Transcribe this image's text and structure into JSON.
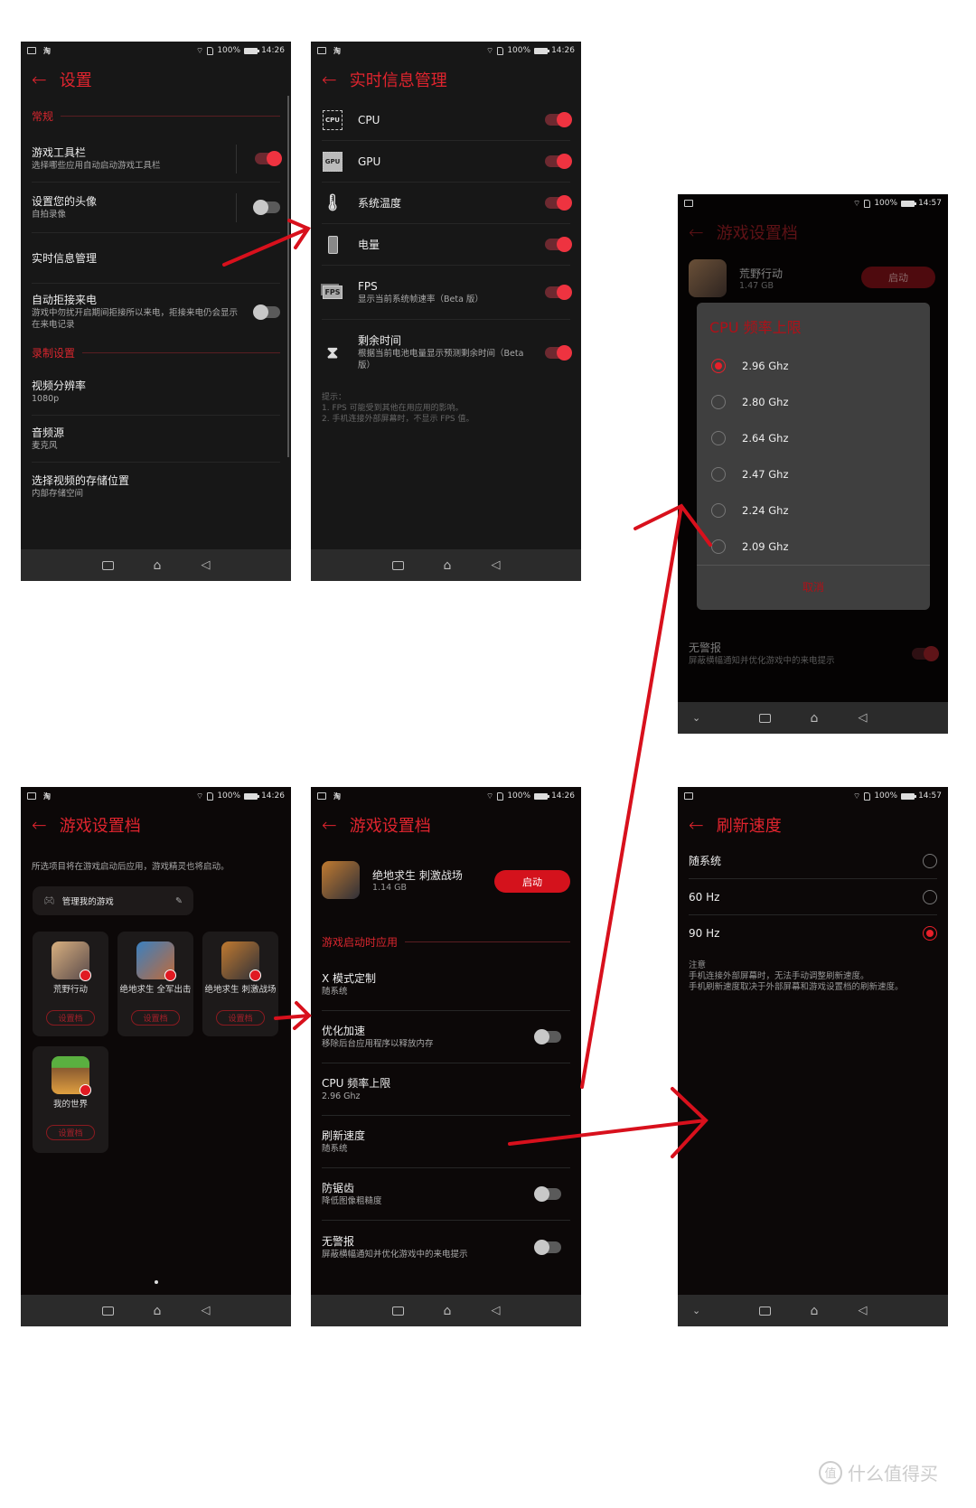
{
  "colors": {
    "accent": "#e0242e",
    "annotation_arrow": "#d8101c",
    "screen_bg": "#171717"
  },
  "status": {
    "battery": "100%",
    "time_a": "14:26",
    "time_b": "14:57",
    "taobao": "淘"
  },
  "settings": {
    "title": "设置",
    "sec_general": "常规",
    "items": [
      {
        "title": "游戏工具栏",
        "sub": "选择哪些应用自动启动游戏工具栏",
        "on": true
      },
      {
        "title": "设置您的头像",
        "sub": "自拍录像",
        "on": false
      },
      {
        "title": "实时信息管理"
      },
      {
        "title": "自动拒接来电",
        "sub": "游戏中勿扰开启期间拒接所以来电，拒接来电仍会显示在来电记录",
        "on": false
      }
    ],
    "sec_record": "录制设置",
    "record": [
      {
        "title": "视频分辨率",
        "sub": "1080p"
      },
      {
        "title": "音频源",
        "sub": "麦克风"
      },
      {
        "title": "选择视频的存储位置",
        "sub": "内部存储空间"
      }
    ]
  },
  "realtime": {
    "title": "实时信息管理",
    "items": [
      {
        "title": "CPU",
        "icon": "CPU",
        "on": true
      },
      {
        "title": "GPU",
        "icon": "GPU",
        "on": true
      },
      {
        "title": "系统温度",
        "icon": "thermometer",
        "on": true
      },
      {
        "title": "电量",
        "icon": "battery",
        "on": true
      },
      {
        "title": "FPS",
        "sub": "显示当前系统帧速率（Beta 版）",
        "icon": "FPS",
        "on": true
      },
      {
        "title": "剩余时间",
        "sub": "根据当前电池电量显示预测剩余时间（Beta 版）",
        "icon": "hourglass",
        "on": true
      }
    ],
    "tip": [
      "提示：",
      "1. FPS 可能受到其他在用应用的影响。",
      "2. 手机连接外部屏幕时，不显示 FPS 值。"
    ]
  },
  "cpu_dialog": {
    "bg_title": "游戏设置档",
    "bg_game": "荒野行动",
    "bg_size": "1.47 GB",
    "bg_launch": "启动",
    "bg_last_title": "无警报",
    "bg_last_sub": "屏蔽横幅通知并优化游戏中的来电提示",
    "title": "CPU 频率上限",
    "options": [
      "2.96 Ghz",
      "2.80 Ghz",
      "2.64 Ghz",
      "2.47 Ghz",
      "2.24 Ghz",
      "2.09 Ghz"
    ],
    "selected": "2.96 Ghz",
    "cancel": "取消"
  },
  "profiles": {
    "title": "游戏设置档",
    "desc": "所选项目将在游戏启动后应用，游戏精灵也将启动。",
    "manage": "管理我的游戏",
    "games": [
      {
        "name": "荒野行动",
        "btn": "设置档"
      },
      {
        "name": "绝地求生 全军出击",
        "btn": "设置档"
      },
      {
        "name": "绝地求生 刺激战场",
        "btn": "设置档"
      },
      {
        "name": "我的世界",
        "btn": "设置档"
      }
    ]
  },
  "profile_detail": {
    "title": "游戏设置档",
    "game": "绝地求生 刺激战场",
    "size": "1.14 GB",
    "launch": "启动",
    "section": "游戏启动时应用",
    "items": [
      {
        "title": "X 模式定制",
        "sub": "随系统"
      },
      {
        "title": "优化加速",
        "sub": "移除后台应用程序以释放内存",
        "on": false
      },
      {
        "title": "CPU 频率上限",
        "sub": "2.96 Ghz"
      },
      {
        "title": "刷新速度",
        "sub": "随系统"
      },
      {
        "title": "防锯齿",
        "sub": "降低图像粗糙度",
        "on": false
      },
      {
        "title": "无警报",
        "sub": "屏蔽横幅通知并优化游戏中的来电提示",
        "on": false
      }
    ]
  },
  "refresh": {
    "title": "刷新速度",
    "options": [
      "随系统",
      "60 Hz",
      "90 Hz"
    ],
    "selected": "90 Hz",
    "note": [
      "注意",
      "手机连接外部屏幕时，无法手动调整刷新速度。",
      "手机刷新速度取决于外部屏幕和游戏设置档的刷新速度。"
    ]
  },
  "watermark": {
    "badge": "值",
    "text": "什么值得买"
  }
}
